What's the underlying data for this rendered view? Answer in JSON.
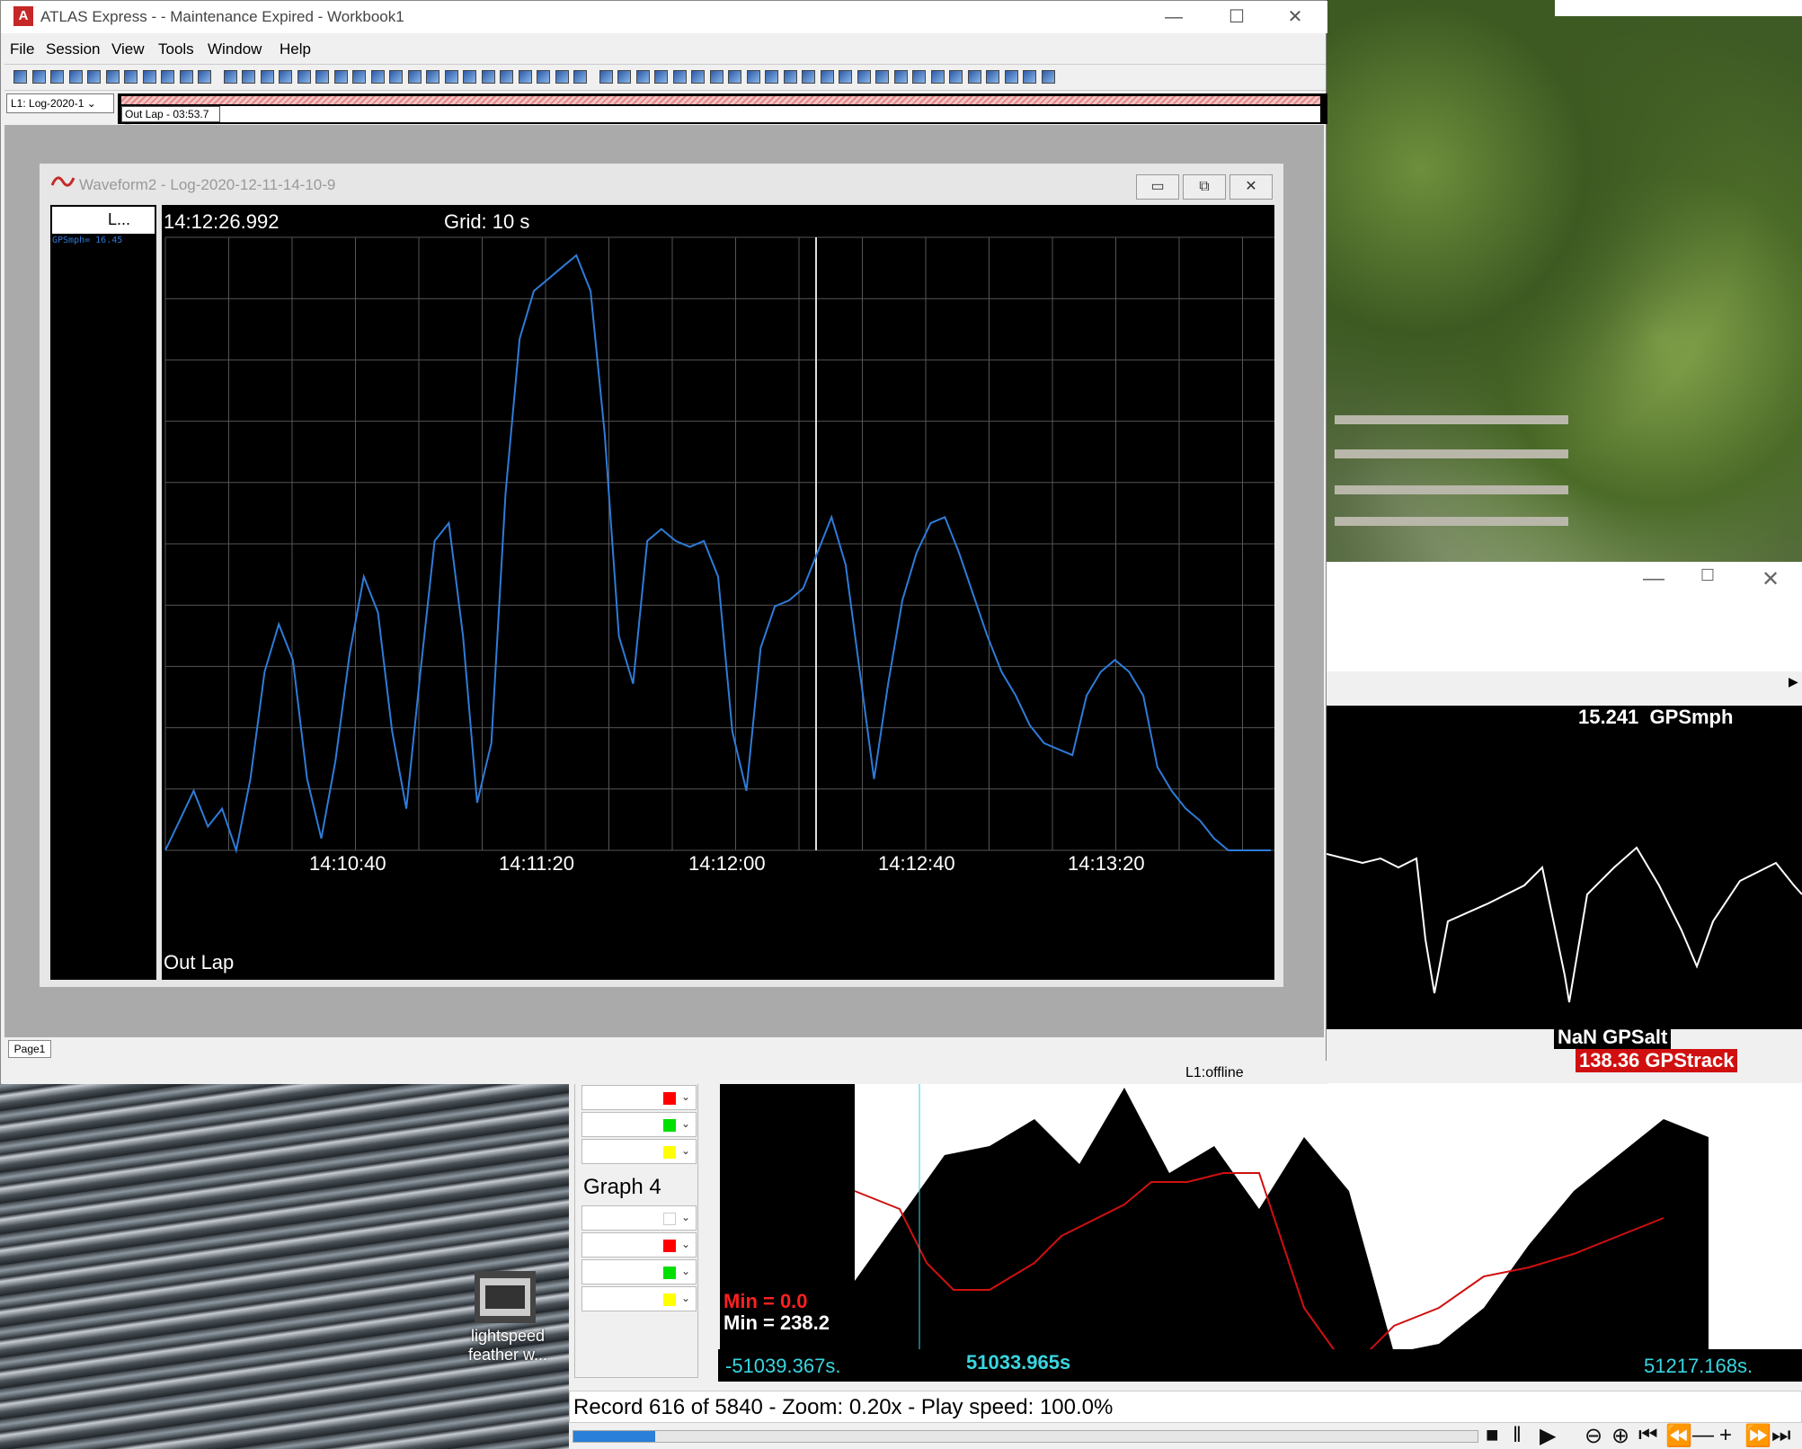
{
  "main_window": {
    "title": "ATLAS Express -  - Maintenance Expired - Workbook1",
    "app_icon_letter": "A",
    "menu": [
      "File",
      "Session",
      "View",
      "Tools",
      "Window",
      "Help"
    ],
    "log_select": "L1: Log-2020-1",
    "lap_select": "Out Lap - 03:53.7",
    "tab": "Page1",
    "status": "L1:offline"
  },
  "waveform": {
    "title": "Waveform2 - Log-2020-12-11-14-10-9",
    "legend_header": "L...",
    "legend_value": "GPSmph= 16.45",
    "cursor_time": "14:12:26.992",
    "grid_label": "Grid: 10 s",
    "lap_label": "Out Lap",
    "series_color": "#2f7bd8",
    "x_ticks": [
      "14:10:40",
      "14:11:20",
      "14:12:00",
      "14:12:40",
      "14:13:20"
    ]
  },
  "right_graph": {
    "value": "15.241",
    "channel": "GPSmph",
    "alt_value": "NaN",
    "alt_channel": "GPSalt",
    "track_value": "138.36",
    "track_channel": "GPStrack"
  },
  "lower_graph": {
    "group_label": "Graph 4",
    "channel_colors_top": [
      "#ff0000",
      "#00e000",
      "#ffff00"
    ],
    "channel_colors_bottom": [
      "#ffffff",
      "#ff0000",
      "#00e000",
      "#ffff00"
    ],
    "min_red": "Min = 0.0",
    "min_white": "Min = 238.2",
    "axis_left": "-51039.367s.",
    "axis_cursor": "51033.965s",
    "axis_right": "51217.168s.",
    "status": "Record 616 of 5840 - Zoom: 0.20x - Play speed: 100.0%",
    "progress_fraction": 0.09
  },
  "desktop_icon": {
    "label": "lightspeed feather w..."
  },
  "chart_data": {
    "type": "line",
    "title": "",
    "xlabel": "",
    "ylabel": "",
    "x_tick_labels": [
      "14:10:40",
      "14:11:20",
      "14:12:00",
      "14:12:40",
      "14:13:20"
    ],
    "series": [
      {
        "name": "GPSmph",
        "t": [
          0,
          3,
          6,
          9,
          12,
          15,
          18,
          21,
          24,
          27,
          30,
          33,
          36,
          39,
          42,
          45,
          48,
          51,
          54,
          57,
          60,
          63,
          66,
          69,
          72,
          75,
          78,
          81,
          84,
          87,
          90,
          93,
          96,
          99,
          102,
          105,
          108,
          111,
          114,
          117,
          120,
          123,
          126,
          129,
          132,
          135,
          138,
          141,
          144,
          147,
          150,
          153,
          156,
          159,
          162,
          165,
          168,
          171,
          174,
          177,
          180,
          183,
          186,
          189,
          192,
          195,
          198,
          201,
          204,
          207,
          210,
          213,
          216,
          219,
          222,
          225,
          228,
          231,
          234
        ],
        "v": [
          0,
          5,
          10,
          4,
          7,
          0,
          12,
          30,
          38,
          32,
          12,
          2,
          15,
          33,
          46,
          40,
          20,
          7,
          30,
          52,
          55,
          36,
          8,
          18,
          60,
          86,
          94,
          96,
          98,
          100,
          94,
          70,
          36,
          28,
          52,
          54,
          52,
          51,
          52,
          46,
          20,
          10,
          34,
          41,
          42,
          44,
          50,
          56,
          48,
          30,
          12,
          28,
          42,
          50,
          55,
          56,
          50,
          43,
          36,
          30,
          26,
          21,
          18,
          17,
          16,
          26,
          30,
          32,
          30,
          26,
          14,
          10,
          7,
          5,
          2,
          0,
          0,
          0,
          0
        ],
        "units_note": "relative speed, 0-100 scale of plot height"
      }
    ]
  }
}
